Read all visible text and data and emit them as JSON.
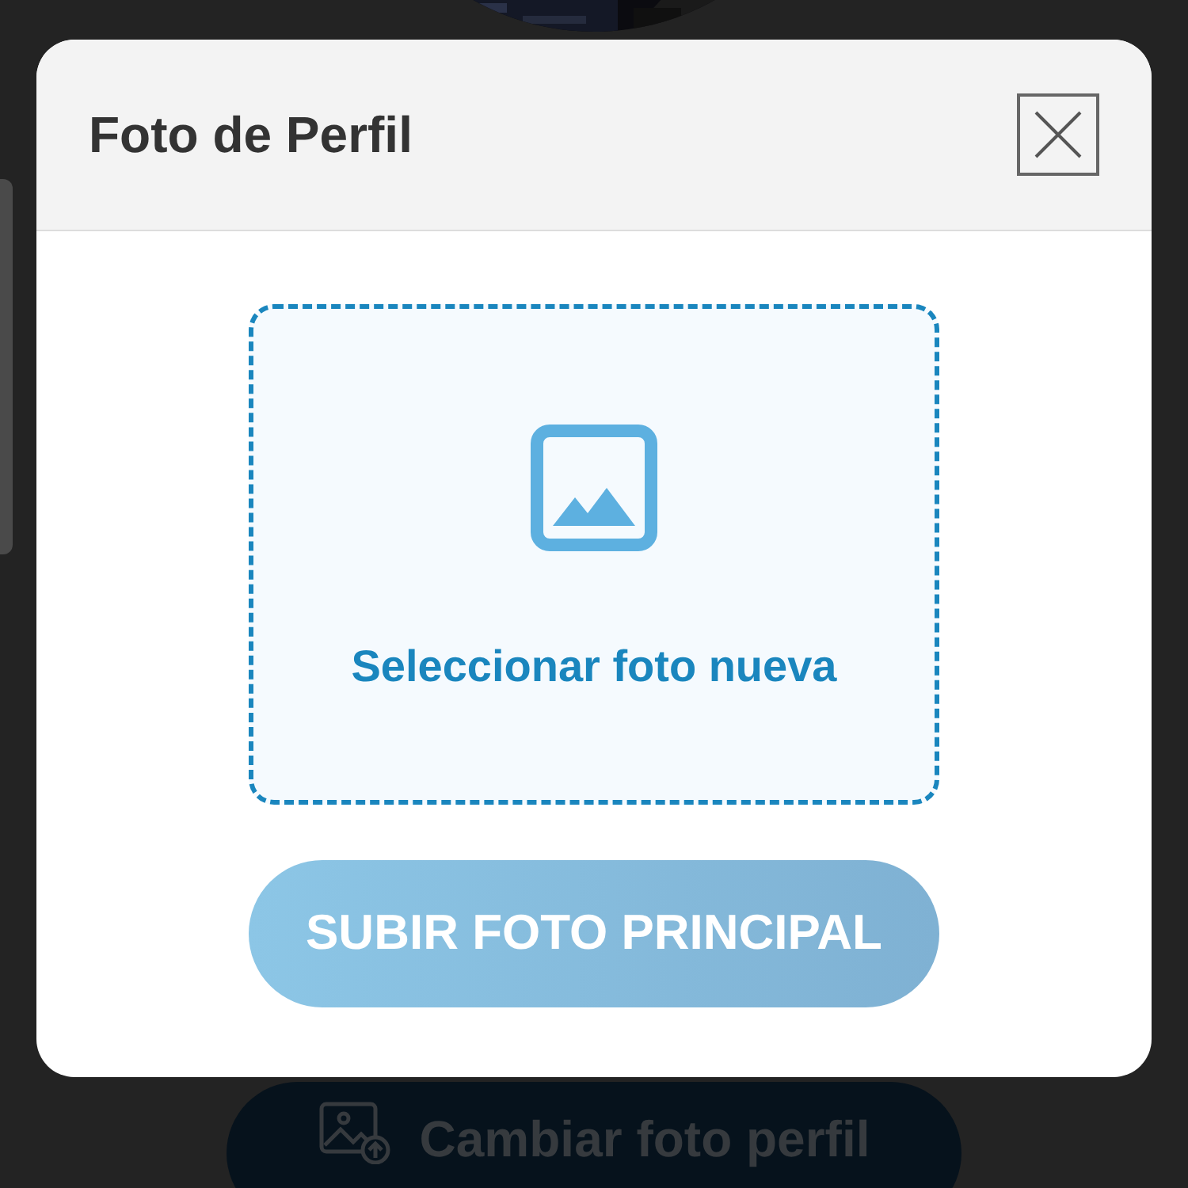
{
  "background": {
    "change_photo_button": {
      "label": "Cambiar foto perfil"
    }
  },
  "dialog": {
    "title": "Foto de Perfil",
    "drop_zone": {
      "label": "Seleccionar foto nueva"
    },
    "upload_button": {
      "label": "SUBIR FOTO PRINCIPAL",
      "disabled": true
    }
  }
}
